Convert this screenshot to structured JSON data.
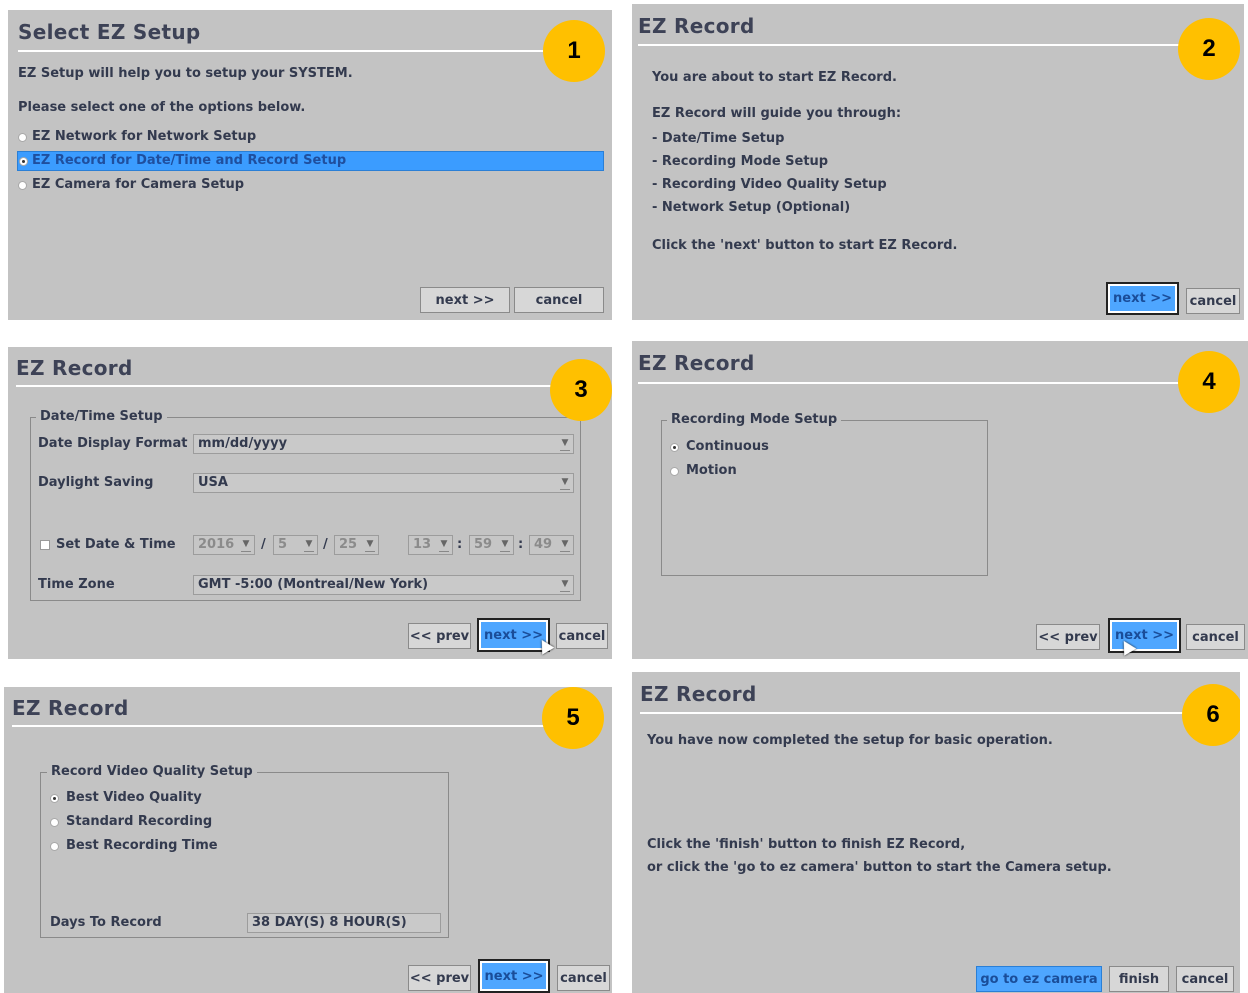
{
  "panel1": {
    "title": "Select EZ Setup",
    "badge": "1",
    "line1": "EZ Setup will help you to setup your SYSTEM.",
    "line2": "Please select one of the options below.",
    "options": [
      "EZ Network for Network Setup",
      "EZ Record for Date/Time and Record Setup",
      "EZ Camera for Camera Setup"
    ],
    "next": "next >>",
    "cancel": "cancel"
  },
  "panel2": {
    "title": "EZ Record",
    "badge": "2",
    "intro": "You are about to start EZ Record.",
    "guide": "EZ Record will guide you through:",
    "steps": [
      "- Date/Time Setup",
      "- Recording Mode Setup",
      "- Recording Video Quality Setup",
      "- Network Setup (Optional)"
    ],
    "footer": "Click the 'next' button to start EZ Record.",
    "next": "next >>",
    "cancel": "cancel"
  },
  "panel3": {
    "title": "EZ Record",
    "badge": "3",
    "group": "Date/Time Setup",
    "date_format_label": "Date Display Format",
    "date_format_value": "mm/dd/yyyy",
    "daylight_label": "Daylight Saving",
    "daylight_value": "USA",
    "set_datetime_label": "Set Date & Time",
    "year": "2016",
    "month": "5",
    "day": "25",
    "hour": "13",
    "minute": "59",
    "second": "49",
    "date_sep": "/",
    "time_sep": ":",
    "timezone_label": "Time Zone",
    "timezone_value": "GMT -5:00 (Montreal/New York)",
    "prev": "<< prev",
    "next": "next >>",
    "cancel": "cancel"
  },
  "panel4": {
    "title": "EZ Record",
    "badge": "4",
    "group": "Recording Mode Setup",
    "options": [
      "Continuous",
      "Motion"
    ],
    "prev": "<< prev",
    "next": "next >>",
    "cancel": "cancel"
  },
  "panel5": {
    "title": "EZ Record",
    "badge": "5",
    "group": "Record Video Quality Setup",
    "options": [
      "Best Video Quality",
      "Standard Recording",
      "Best Recording Time"
    ],
    "days_label": "Days To Record",
    "days_value": "38 DAY(S) 8 HOUR(S)",
    "prev": "<< prev",
    "next": "next >>",
    "cancel": "cancel"
  },
  "panel6": {
    "title": "EZ Record",
    "badge": "6",
    "line1": "You have now completed the setup for basic operation.",
    "line2": "Click the 'finish' button to finish EZ Record,",
    "line3": "or click the 'go to ez camera' button to start the Camera setup.",
    "go_camera": "go to ez camera",
    "finish": "finish",
    "cancel": "cancel"
  },
  "arrow_glyph": "▼"
}
